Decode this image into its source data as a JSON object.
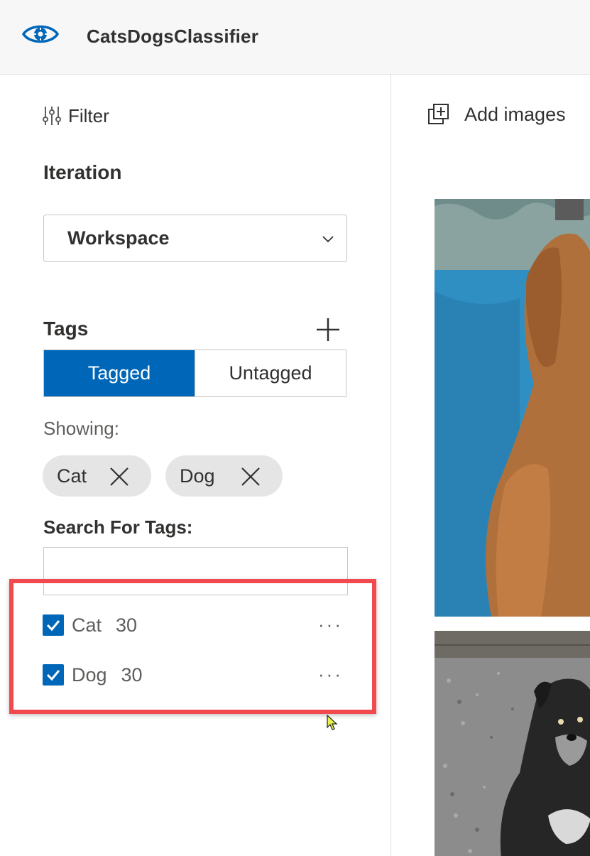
{
  "header": {
    "app_title": "CatsDogsClassifier",
    "icon": "eye-gear-icon"
  },
  "sidebar": {
    "filter_label": "Filter",
    "iteration_label": "Iteration",
    "iteration_value": "Workspace",
    "tags_label": "Tags",
    "segment": {
      "tagged": "Tagged",
      "untagged": "Untagged",
      "selected": "tagged"
    },
    "showing_label": "Showing:",
    "chips": [
      {
        "label": "Cat"
      },
      {
        "label": "Dog"
      }
    ],
    "search_label": "Search For Tags:",
    "search_value": "",
    "tags": [
      {
        "name": "Cat",
        "count": "30",
        "checked": true
      },
      {
        "name": "Dog",
        "count": "30",
        "checked": true
      }
    ],
    "more_label": "···",
    "highlight_color": "#f2494f"
  },
  "main": {
    "add_images_label": "Add images"
  },
  "colors": {
    "accent": "#0067b8"
  }
}
